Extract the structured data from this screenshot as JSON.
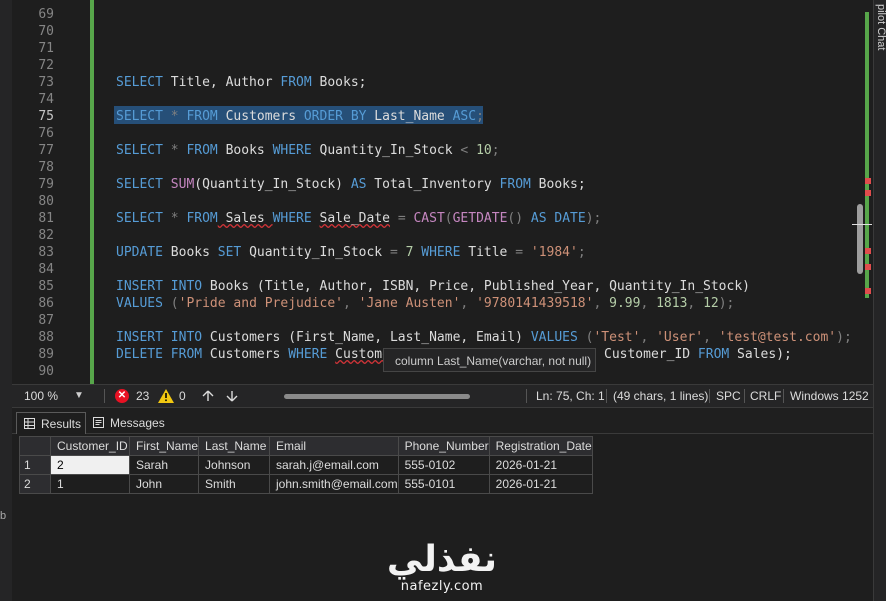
{
  "editor": {
    "line_numbers": [
      "69",
      "70",
      "71",
      "72",
      "73",
      "74",
      "75",
      "76",
      "77",
      "78",
      "79",
      "80",
      "81",
      "82",
      "83",
      "84",
      "85",
      "86",
      "87",
      "88",
      "89",
      "90"
    ],
    "active_line": "75",
    "code": {
      "l73": {
        "kw1": "SELECT",
        "t1": " Title, Author ",
        "kw2": "FROM",
        "t2": " Books;"
      },
      "l75": {
        "kw1": "SELECT",
        "op1": " * ",
        "kw2": "FROM",
        "t1": " Customers ",
        "kw3": "ORDER BY",
        "t2": " Last_Name ",
        "kw4": "ASC",
        "t3": ";"
      },
      "l77": {
        "kw1": "SELECT",
        "op1": " * ",
        "kw2": "FROM",
        "t1": " Books ",
        "kw3": "WHERE",
        "t2": " Quantity_In_Stock ",
        "op2": "<",
        "sp": " ",
        "n1": "10",
        "t3": ";"
      },
      "l79": {
        "kw1": "SELECT",
        "sp": " ",
        "fn1": "SUM",
        "t1": "(Quantity_In_Stock) ",
        "kw2": "AS",
        "t2": " Total_Inventory ",
        "kw3": "FROM",
        "t3": " Books;"
      },
      "l81": {
        "kw1": "SELECT",
        "op1": " * ",
        "kw2": "FROM",
        "t1": " Sales ",
        "kw3": "WHERE",
        "sp1": " ",
        "t2": "Sale_Date",
        "sp2": " ",
        "op2": "=",
        "sp3": " ",
        "fn1": "CAST",
        "t3": "(",
        "fn2": "GETDATE",
        "t4": "() ",
        "kw4": "AS",
        "sp4": " ",
        "kw5": "DATE",
        "t5": ");"
      },
      "l83": {
        "kw1": "UPDATE",
        "t1": " Books ",
        "kw2": "SET",
        "t2": " Quantity_In_Stock ",
        "op1": "=",
        "sp": " ",
        "n1": "7",
        "sp2": " ",
        "kw3": "WHERE",
        "t3": " Title ",
        "op2": "=",
        "sp3": " ",
        "s1": "'1984'",
        "t4": ";"
      },
      "l85": {
        "kw1": "INSERT",
        "sp": " ",
        "kw2": "INTO",
        "t1": " Books (Title, Author, ISBN, Price, Published_Year, Quantity_In_Stock)"
      },
      "l86": {
        "kw1": "VALUES",
        "t1": " (",
        "s1": "'Pride and Prejudice'",
        "c1": ", ",
        "s2": "'Jane Austen'",
        "c2": ", ",
        "s3": "'9780141439518'",
        "c3": ", ",
        "n1": "9.99",
        "c4": ", ",
        "n2": "1813",
        "c5": ", ",
        "n3": "12",
        "t2": ");"
      },
      "l88": {
        "kw1": "INSERT",
        "sp": " ",
        "kw2": "INTO",
        "t1": " Customers (First_Name, Last_Name, Email) ",
        "kw3": "VALUES",
        "t2": " (",
        "s1": "'Test'",
        "c1": ", ",
        "s2": "'User'",
        "c2": ", ",
        "s3": "'test@test.com'",
        "t3": ");"
      },
      "l89": {
        "kw1": "DELETE",
        "sp": " ",
        "kw2": "FROM",
        "t1": " Customers ",
        "kw3": "WHERE",
        "sp2": " ",
        "t2": "Custome",
        "tail_id": "Customer_ID",
        "tail_sp": " ",
        "tail_kw": "FROM",
        "tail_t": " Sales);"
      }
    },
    "tooltip": "column Last_Name(varchar, not null)"
  },
  "statusbar": {
    "zoom": "100 %",
    "errors": "23",
    "warnings": "0",
    "position": "Ln: 75, Ch: 1",
    "selection": "(49 chars, 1 lines)",
    "indent": "SPC",
    "eol": "CRLF",
    "encoding": "Windows 1252"
  },
  "tabs": {
    "results": "Results",
    "messages": "Messages"
  },
  "grid": {
    "columns": [
      "Customer_ID",
      "First_Name",
      "Last_Name",
      "Email",
      "Phone_Number",
      "Registration_Date"
    ],
    "rows": [
      {
        "n": "1",
        "cells": [
          "2",
          "Sarah",
          "Johnson",
          "sarah.j@email.com",
          "555-0102",
          "2026-01-21"
        ]
      },
      {
        "n": "2",
        "cells": [
          "1",
          "John",
          "Smith",
          "john.smith@email.com",
          "555-0101",
          "2026-01-21"
        ]
      }
    ]
  },
  "side": {
    "right_tab": "pilot Chat",
    "left_indicator": "b"
  },
  "watermark": {
    "arabic": "نفذلي",
    "latin": "nafezly.com"
  },
  "colors": {
    "keyword": "#569cd6",
    "function": "#c586c0",
    "string": "#ce9178",
    "number": "#b5cea8",
    "selection": "#264f78",
    "change_bar": "#57a64a",
    "error": "#e81123"
  }
}
